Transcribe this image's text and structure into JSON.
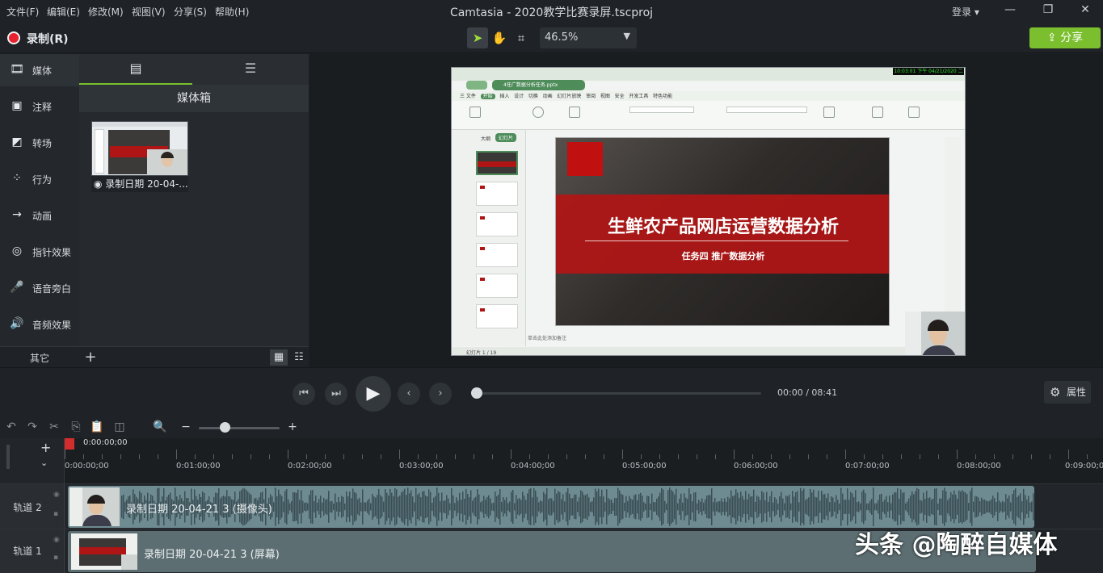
{
  "menu": [
    "文件(F)",
    "编辑(E)",
    "修改(M)",
    "视图(V)",
    "分享(S)",
    "帮助(H)"
  ],
  "window": {
    "title": "Camtasia - 2020教学比赛录屏.tscproj",
    "login": "登录 ▾",
    "minimize": "—",
    "restore": "❐",
    "close": "✕"
  },
  "toolbar": {
    "record_label": "录制(R)",
    "zoom": "46.5%",
    "share_label": "分享"
  },
  "sidebar": {
    "items": [
      {
        "label": "媒体",
        "icon": "film-icon"
      },
      {
        "label": "注释",
        "icon": "annotation-icon"
      },
      {
        "label": "转场",
        "icon": "transition-icon"
      },
      {
        "label": "行为",
        "icon": "behavior-icon"
      },
      {
        "label": "动画",
        "icon": "animation-icon"
      },
      {
        "label": "指针效果",
        "icon": "cursor-effects-icon"
      },
      {
        "label": "语音旁白",
        "icon": "microphone-icon"
      },
      {
        "label": "音频效果",
        "icon": "speaker-icon"
      }
    ],
    "more": "其它",
    "add": "+"
  },
  "media_bin": {
    "title": "媒体箱",
    "items": [
      {
        "label": "◉ 录制日期 20-04-..."
      }
    ]
  },
  "preview": {
    "slide_title": "生鲜农产品网店运营数据分析",
    "slide_subtitle": "任务四  推广数据分析",
    "clock": "10:03:01 下午 04/21/2020 二",
    "file_tab": "4任广数据分析任务.pptx",
    "menu_tabs": [
      "三 文件",
      "开始",
      "插入",
      "设计",
      "切换",
      "动画",
      "幻灯片放映",
      "审阅",
      "视图",
      "安全",
      "开发工具",
      "特色功能"
    ],
    "panel_tabs": [
      "大纲",
      "幻灯片"
    ],
    "notes_hint": "单击此处添加备注",
    "status": "幻灯片 1 / 19"
  },
  "player": {
    "current": "00:00",
    "separator": "/",
    "total": "08:41",
    "properties": "属性"
  },
  "timeline": {
    "playhead_time": "0:00:00;00",
    "ruler": [
      "0:00:00;00",
      "0:01:00;00",
      "0:02:00;00",
      "0:03:00;00",
      "0:04:00;00",
      "0:05:00;00",
      "0:06:00;00",
      "0:07:00;00",
      "0:08:00;00",
      "0:09:00;00"
    ],
    "tracks": [
      {
        "name": "轨道 2",
        "clip": "录制日期 20-04-21 3 (摄像头)"
      },
      {
        "name": "轨道 1",
        "clip": "录制日期 20-04-21 3 (屏幕)"
      }
    ]
  },
  "watermark": "头条 @陶醉自媒体",
  "colors": {
    "accent": "#7bbf2e",
    "record": "#e8212e",
    "slide_red": "#b01515",
    "clip_audio": "#6f8b92",
    "clip_screen": "#5c6e72"
  }
}
